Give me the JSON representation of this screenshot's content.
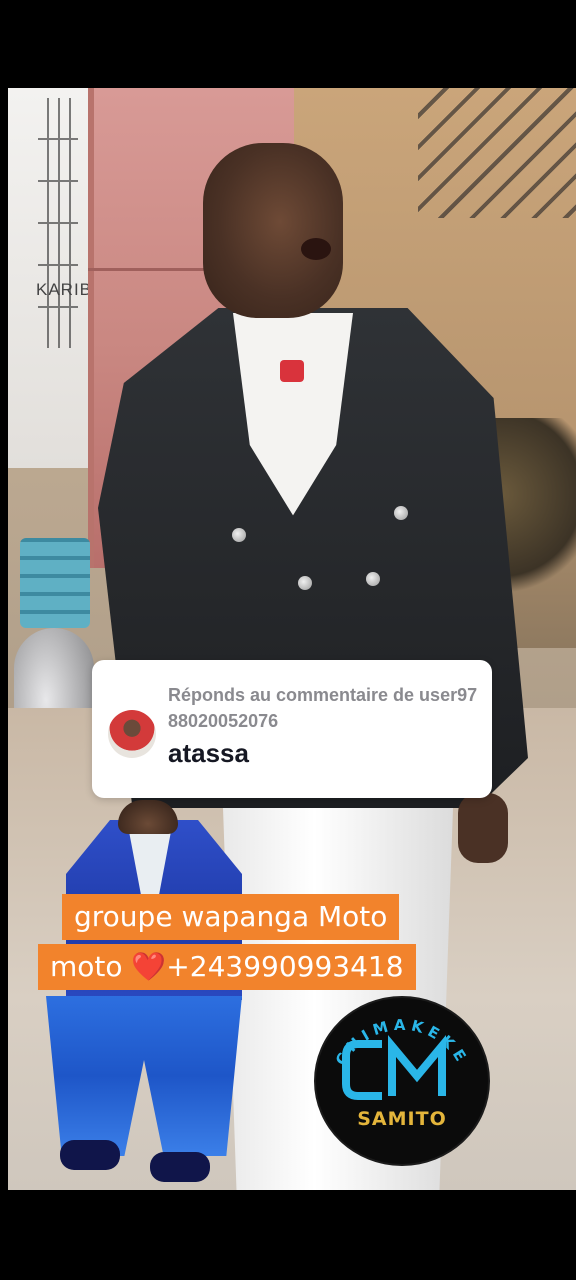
{
  "comment": {
    "reply_label": "Réponds au commentaire de user9788020052076",
    "text": "atassa"
  },
  "background_sign": "KARIB",
  "promo": {
    "line1": "groupe wapanga Moto",
    "line2_prefix": "moto",
    "heart": "❤️",
    "line2_suffix": "+243990993418"
  },
  "logo": {
    "arc_text": "CHIMAKEKE",
    "monogram": "CM",
    "brand": "SAMITO"
  },
  "colors": {
    "promo_orange": "#f2832c",
    "logo_cyan": "#2ab6e8",
    "logo_gold": "#e4b53b"
  },
  "icons": [
    "heart-icon"
  ]
}
